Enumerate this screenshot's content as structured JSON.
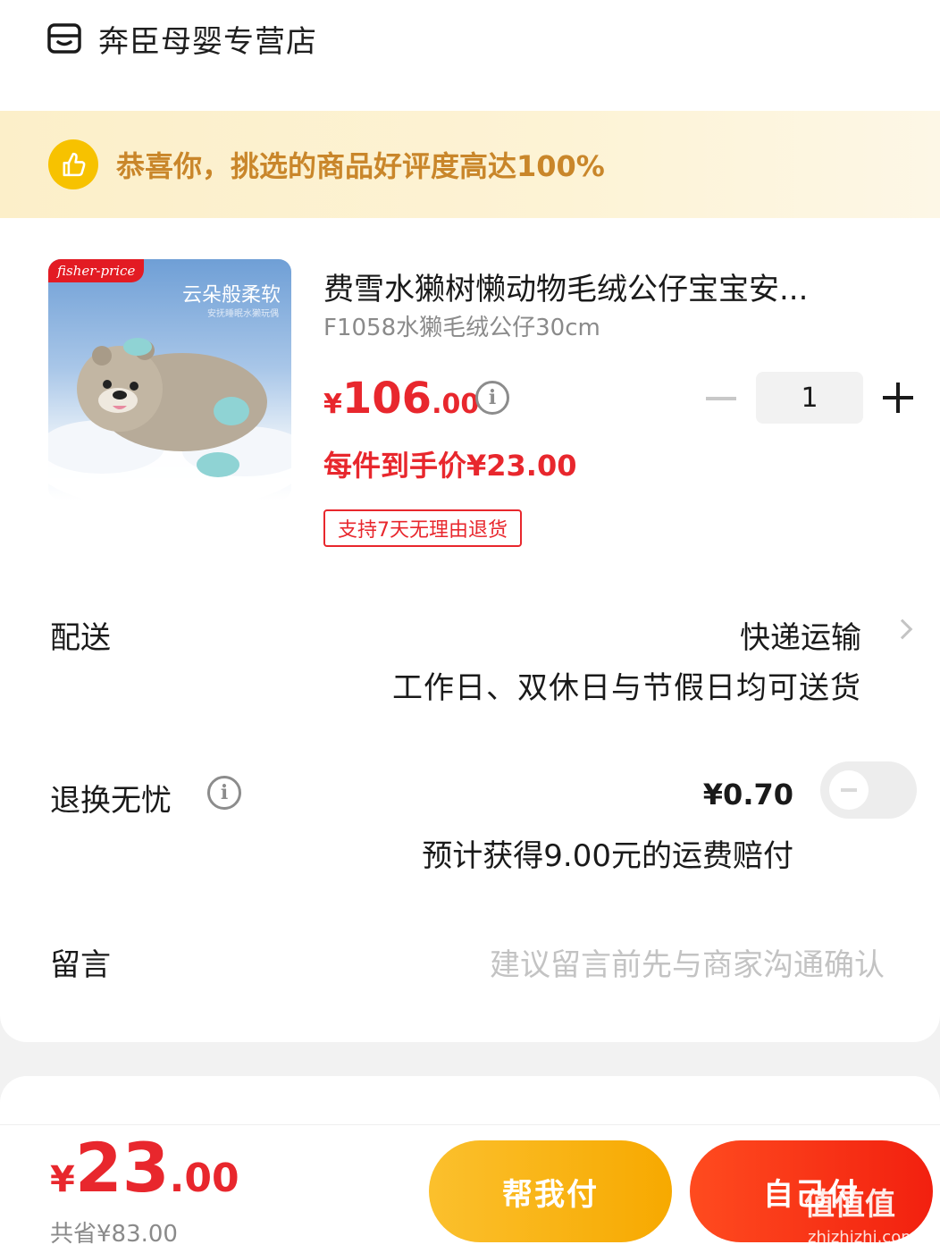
{
  "store": {
    "name": "奔臣母婴专营店",
    "icon": "store-icon"
  },
  "banner": {
    "text": "恭喜你，挑选的商品好评度高达100%",
    "icon": "thumbs-up-icon"
  },
  "product": {
    "brand": "fisher-price",
    "image_caption": "云朵般柔软",
    "image_subcaption": "安抚睡眠水獭玩偶",
    "title": "费雪水獭树懒动物毛绒公仔宝宝安...",
    "variant": "F1058水獭毛绒公仔30cm",
    "price_symbol": "¥",
    "price_int": "106",
    "price_dec": ".00",
    "unit_price_text": "每件到手价¥23.00",
    "return_policy": "支持7天无理由退货",
    "quantity": "1"
  },
  "delivery": {
    "label": "配送",
    "method": "快递运输",
    "note": "工作日、双休日与节假日均可送货"
  },
  "insurance": {
    "label": "退换无忧",
    "price": "¥0.70",
    "note": "预计获得9.00元的运费赔付",
    "enabled": false
  },
  "message": {
    "label": "留言",
    "placeholder": "建议留言前先与商家沟通确认"
  },
  "footer": {
    "total_symbol": "¥",
    "total_int": "23",
    "total_dec": ".00",
    "saved": "共省¥83.00",
    "help_pay_label": "帮我付",
    "self_pay_label": "自己付"
  },
  "watermark": {
    "text": "值值值",
    "sub": "zhizhizhi.com"
  },
  "colors": {
    "price_red": "#e8272d",
    "banner_text": "#c9862a",
    "help_pay": "#fbc02d",
    "self_pay": "#ff4b1f"
  }
}
